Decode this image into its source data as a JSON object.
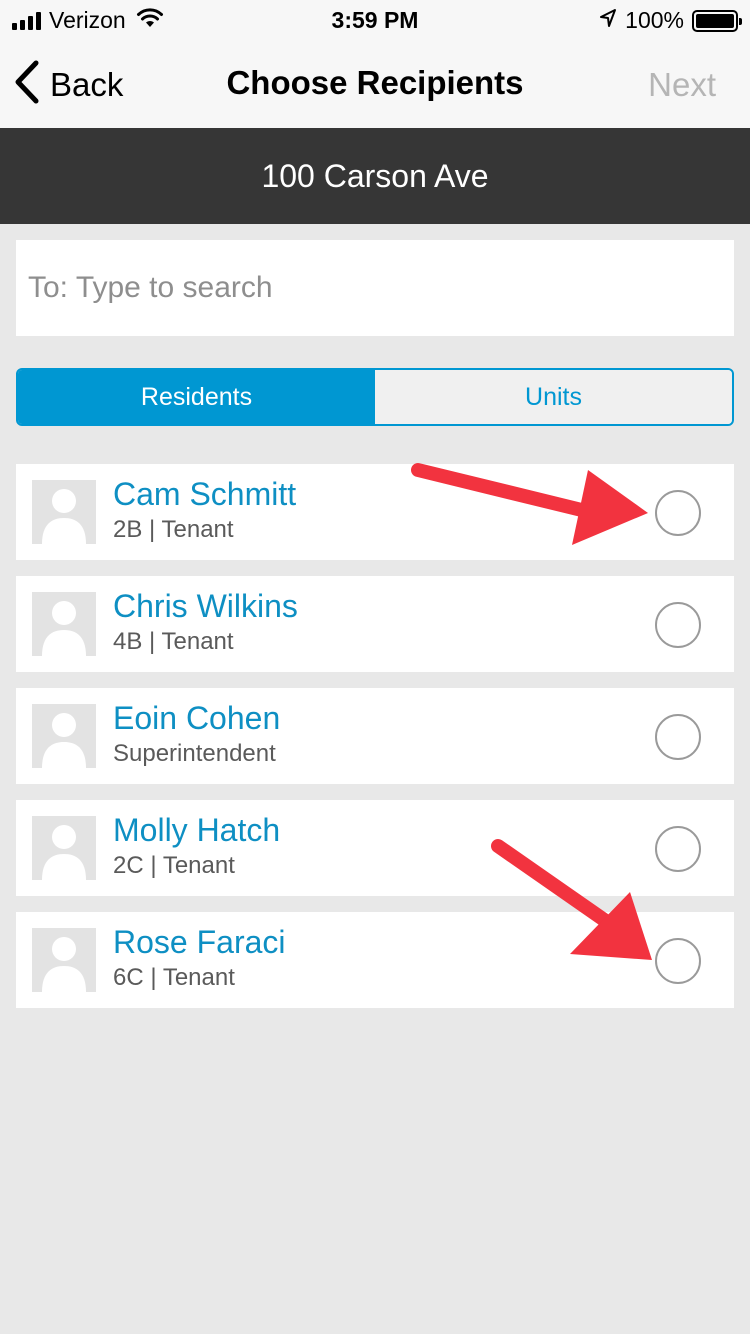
{
  "status_bar": {
    "carrier": "Verizon",
    "time": "3:59 PM",
    "battery_percent": "100%",
    "battery_level": 1.0,
    "signal_bars": 4,
    "icons": [
      "signal-bars-icon",
      "wifi-icon",
      "location-arrow-icon",
      "battery-icon"
    ]
  },
  "nav": {
    "back_label": "Back",
    "title": "Choose Recipients",
    "next_label": "Next"
  },
  "building": {
    "name": "100 Carson Ave"
  },
  "search": {
    "placeholder": "To: Type to search",
    "value": ""
  },
  "tabs": [
    {
      "label": "Residents",
      "active": true
    },
    {
      "label": "Units",
      "active": false
    }
  ],
  "residents": [
    {
      "name": "Cam Schmitt",
      "detail": "2B | Tenant",
      "selected": false
    },
    {
      "name": "Chris Wilkins",
      "detail": "4B | Tenant",
      "selected": false
    },
    {
      "name": "Eoin Cohen",
      "detail": "Superintendent",
      "selected": false
    },
    {
      "name": "Molly Hatch",
      "detail": "2C | Tenant",
      "selected": false
    },
    {
      "name": "Rose Faraci",
      "detail": "6C | Tenant",
      "selected": false
    }
  ],
  "colors": {
    "accent": "#0097d2",
    "name_text": "#0e8fc3",
    "header_dark": "#363636",
    "background": "#e8e8e8",
    "annotation_arrow": "#f2333f"
  }
}
